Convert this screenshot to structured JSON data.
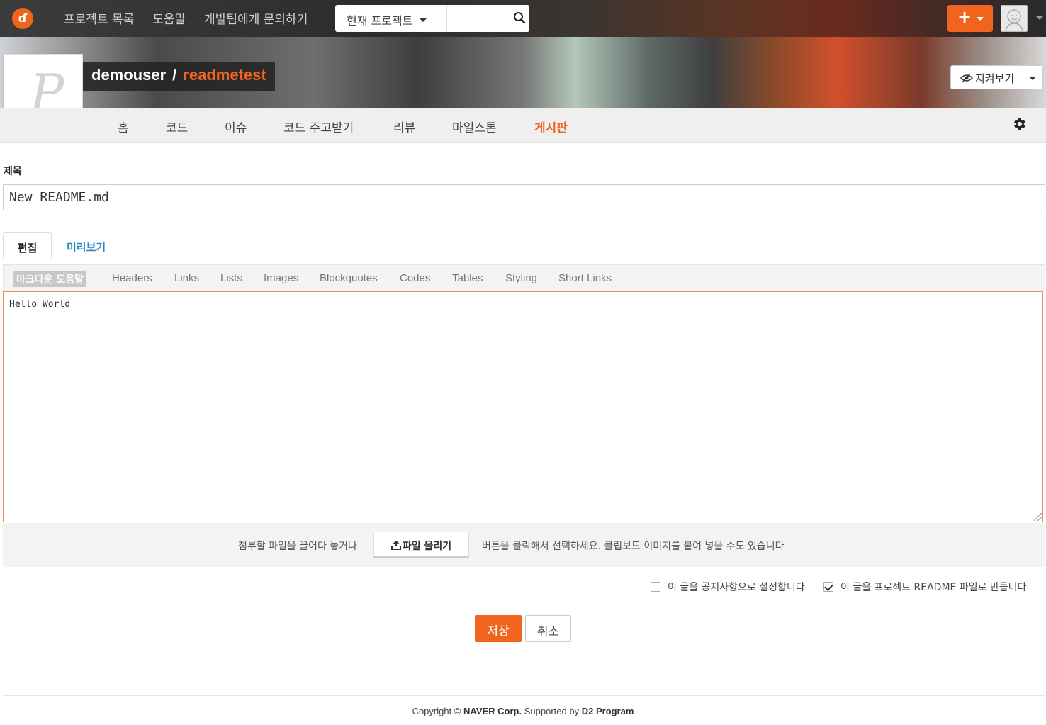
{
  "topbar": {
    "logo_glyph": "ɗ",
    "nav": [
      "프로젝트 목록",
      "도움말",
      "개발팀에게 문의하기"
    ],
    "scope_label": "현재 프로젝트",
    "search_placeholder": "",
    "new_button_glyph": "+",
    "accent": "#f0641e"
  },
  "project": {
    "avatar_letter": "P",
    "owner": "demouser",
    "separator": "/",
    "name": "readmetest",
    "watch_label": "지켜보기"
  },
  "menu": {
    "items": [
      "홈",
      "코드",
      "이슈",
      "코드 주고받기",
      "리뷰",
      "마일스톤",
      "게시판"
    ],
    "active": "게시판"
  },
  "form": {
    "title_label": "제목",
    "title_value": "New README.md",
    "tab_edit": "편집",
    "tab_preview": "미리보기",
    "help_badge": "마크다운 도움말",
    "help_links": [
      "Headers",
      "Links",
      "Lists",
      "Images",
      "Blockquotes",
      "Codes",
      "Tables",
      "Styling",
      "Short Links"
    ],
    "body_value": "Hello World",
    "upload_text_before": "첨부할 파일을 끌어다 놓거나",
    "upload_button": "파일 올리기",
    "upload_text_after": "버튼을 클릭해서 선택하세요. 클립보드 이미지를 붙여 넣을 수도 있습니다",
    "notice_option": "이 글을 공지사항으로 설정합니다",
    "notice_checked": false,
    "readme_option": "이 글을 프로젝트 README 파일로 만듭니다",
    "readme_checked": true,
    "save_label": "저장",
    "cancel_label": "취소"
  },
  "footer": {
    "copyright": "Copyright ©",
    "company": "NAVER Corp.",
    "supported": "Supported by",
    "program": "D2 Program"
  }
}
